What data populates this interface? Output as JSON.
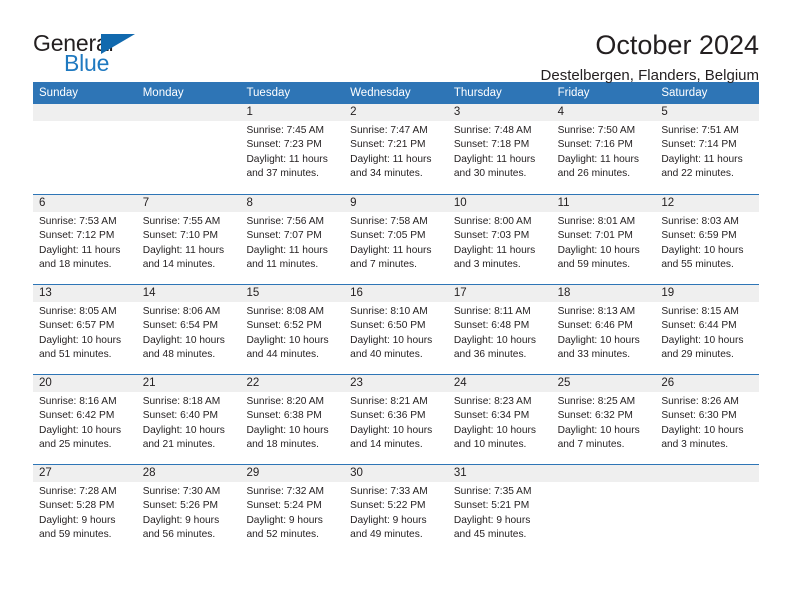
{
  "logo": {
    "word_one": "General",
    "word_two": "Blue",
    "accent_color": "#1169ae"
  },
  "header": {
    "title": "October 2024",
    "subtitle": "Destelbergen, Flanders, Belgium",
    "header_bg_color": "#2e75b6"
  },
  "calendar": {
    "weekdays": [
      "Sunday",
      "Monday",
      "Tuesday",
      "Wednesday",
      "Thursday",
      "Friday",
      "Saturday"
    ],
    "weeks": [
      [
        {
          "day": "",
          "empty": true
        },
        {
          "day": "",
          "empty": true
        },
        {
          "day": "1",
          "sunrise": "Sunrise: 7:45 AM",
          "sunset": "Sunset: 7:23 PM",
          "daylight_line1": "Daylight: 11 hours",
          "daylight_line2": "and 37 minutes."
        },
        {
          "day": "2",
          "sunrise": "Sunrise: 7:47 AM",
          "sunset": "Sunset: 7:21 PM",
          "daylight_line1": "Daylight: 11 hours",
          "daylight_line2": "and 34 minutes."
        },
        {
          "day": "3",
          "sunrise": "Sunrise: 7:48 AM",
          "sunset": "Sunset: 7:18 PM",
          "daylight_line1": "Daylight: 11 hours",
          "daylight_line2": "and 30 minutes."
        },
        {
          "day": "4",
          "sunrise": "Sunrise: 7:50 AM",
          "sunset": "Sunset: 7:16 PM",
          "daylight_line1": "Daylight: 11 hours",
          "daylight_line2": "and 26 minutes."
        },
        {
          "day": "5",
          "sunrise": "Sunrise: 7:51 AM",
          "sunset": "Sunset: 7:14 PM",
          "daylight_line1": "Daylight: 11 hours",
          "daylight_line2": "and 22 minutes."
        }
      ],
      [
        {
          "day": "6",
          "sunrise": "Sunrise: 7:53 AM",
          "sunset": "Sunset: 7:12 PM",
          "daylight_line1": "Daylight: 11 hours",
          "daylight_line2": "and 18 minutes."
        },
        {
          "day": "7",
          "sunrise": "Sunrise: 7:55 AM",
          "sunset": "Sunset: 7:10 PM",
          "daylight_line1": "Daylight: 11 hours",
          "daylight_line2": "and 14 minutes."
        },
        {
          "day": "8",
          "sunrise": "Sunrise: 7:56 AM",
          "sunset": "Sunset: 7:07 PM",
          "daylight_line1": "Daylight: 11 hours",
          "daylight_line2": "and 11 minutes."
        },
        {
          "day": "9",
          "sunrise": "Sunrise: 7:58 AM",
          "sunset": "Sunset: 7:05 PM",
          "daylight_line1": "Daylight: 11 hours",
          "daylight_line2": "and 7 minutes."
        },
        {
          "day": "10",
          "sunrise": "Sunrise: 8:00 AM",
          "sunset": "Sunset: 7:03 PM",
          "daylight_line1": "Daylight: 11 hours",
          "daylight_line2": "and 3 minutes."
        },
        {
          "day": "11",
          "sunrise": "Sunrise: 8:01 AM",
          "sunset": "Sunset: 7:01 PM",
          "daylight_line1": "Daylight: 10 hours",
          "daylight_line2": "and 59 minutes."
        },
        {
          "day": "12",
          "sunrise": "Sunrise: 8:03 AM",
          "sunset": "Sunset: 6:59 PM",
          "daylight_line1": "Daylight: 10 hours",
          "daylight_line2": "and 55 minutes."
        }
      ],
      [
        {
          "day": "13",
          "sunrise": "Sunrise: 8:05 AM",
          "sunset": "Sunset: 6:57 PM",
          "daylight_line1": "Daylight: 10 hours",
          "daylight_line2": "and 51 minutes."
        },
        {
          "day": "14",
          "sunrise": "Sunrise: 8:06 AM",
          "sunset": "Sunset: 6:54 PM",
          "daylight_line1": "Daylight: 10 hours",
          "daylight_line2": "and 48 minutes."
        },
        {
          "day": "15",
          "sunrise": "Sunrise: 8:08 AM",
          "sunset": "Sunset: 6:52 PM",
          "daylight_line1": "Daylight: 10 hours",
          "daylight_line2": "and 44 minutes."
        },
        {
          "day": "16",
          "sunrise": "Sunrise: 8:10 AM",
          "sunset": "Sunset: 6:50 PM",
          "daylight_line1": "Daylight: 10 hours",
          "daylight_line2": "and 40 minutes."
        },
        {
          "day": "17",
          "sunrise": "Sunrise: 8:11 AM",
          "sunset": "Sunset: 6:48 PM",
          "daylight_line1": "Daylight: 10 hours",
          "daylight_line2": "and 36 minutes."
        },
        {
          "day": "18",
          "sunrise": "Sunrise: 8:13 AM",
          "sunset": "Sunset: 6:46 PM",
          "daylight_line1": "Daylight: 10 hours",
          "daylight_line2": "and 33 minutes."
        },
        {
          "day": "19",
          "sunrise": "Sunrise: 8:15 AM",
          "sunset": "Sunset: 6:44 PM",
          "daylight_line1": "Daylight: 10 hours",
          "daylight_line2": "and 29 minutes."
        }
      ],
      [
        {
          "day": "20",
          "sunrise": "Sunrise: 8:16 AM",
          "sunset": "Sunset: 6:42 PM",
          "daylight_line1": "Daylight: 10 hours",
          "daylight_line2": "and 25 minutes."
        },
        {
          "day": "21",
          "sunrise": "Sunrise: 8:18 AM",
          "sunset": "Sunset: 6:40 PM",
          "daylight_line1": "Daylight: 10 hours",
          "daylight_line2": "and 21 minutes."
        },
        {
          "day": "22",
          "sunrise": "Sunrise: 8:20 AM",
          "sunset": "Sunset: 6:38 PM",
          "daylight_line1": "Daylight: 10 hours",
          "daylight_line2": "and 18 minutes."
        },
        {
          "day": "23",
          "sunrise": "Sunrise: 8:21 AM",
          "sunset": "Sunset: 6:36 PM",
          "daylight_line1": "Daylight: 10 hours",
          "daylight_line2": "and 14 minutes."
        },
        {
          "day": "24",
          "sunrise": "Sunrise: 8:23 AM",
          "sunset": "Sunset: 6:34 PM",
          "daylight_line1": "Daylight: 10 hours",
          "daylight_line2": "and 10 minutes."
        },
        {
          "day": "25",
          "sunrise": "Sunrise: 8:25 AM",
          "sunset": "Sunset: 6:32 PM",
          "daylight_line1": "Daylight: 10 hours",
          "daylight_line2": "and 7 minutes."
        },
        {
          "day": "26",
          "sunrise": "Sunrise: 8:26 AM",
          "sunset": "Sunset: 6:30 PM",
          "daylight_line1": "Daylight: 10 hours",
          "daylight_line2": "and 3 minutes."
        }
      ],
      [
        {
          "day": "27",
          "sunrise": "Sunrise: 7:28 AM",
          "sunset": "Sunset: 5:28 PM",
          "daylight_line1": "Daylight: 9 hours",
          "daylight_line2": "and 59 minutes."
        },
        {
          "day": "28",
          "sunrise": "Sunrise: 7:30 AM",
          "sunset": "Sunset: 5:26 PM",
          "daylight_line1": "Daylight: 9 hours",
          "daylight_line2": "and 56 minutes."
        },
        {
          "day": "29",
          "sunrise": "Sunrise: 7:32 AM",
          "sunset": "Sunset: 5:24 PM",
          "daylight_line1": "Daylight: 9 hours",
          "daylight_line2": "and 52 minutes."
        },
        {
          "day": "30",
          "sunrise": "Sunrise: 7:33 AM",
          "sunset": "Sunset: 5:22 PM",
          "daylight_line1": "Daylight: 9 hours",
          "daylight_line2": "and 49 minutes."
        },
        {
          "day": "31",
          "sunrise": "Sunrise: 7:35 AM",
          "sunset": "Sunset: 5:21 PM",
          "daylight_line1": "Daylight: 9 hours",
          "daylight_line2": "and 45 minutes."
        },
        {
          "day": "",
          "empty": true
        },
        {
          "day": "",
          "empty": true
        }
      ]
    ]
  }
}
